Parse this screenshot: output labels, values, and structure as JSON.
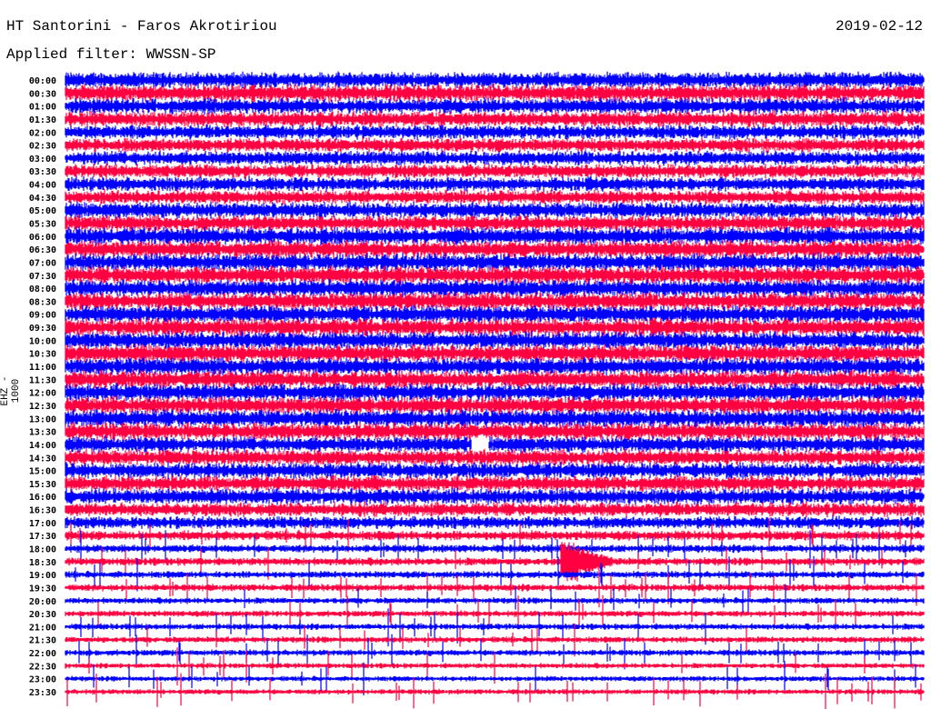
{
  "header": {
    "station": "HT Santorini - Faros Akrotiriou",
    "date": "2019-02-12",
    "filter": "Applied filter: WWSSN-SP"
  },
  "chart_data": {
    "type": "line",
    "subtype": "helicorder",
    "channel_label": "EHZ - 1000",
    "minutes_per_row": 30,
    "colors": [
      "#0000ff",
      "#ff0040"
    ],
    "rows": [
      {
        "label": "00:00",
        "amp": 0.9
      },
      {
        "label": "00:30",
        "amp": 1.0
      },
      {
        "label": "01:00",
        "amp": 0.9
      },
      {
        "label": "01:30",
        "amp": 0.9
      },
      {
        "label": "02:00",
        "amp": 0.8
      },
      {
        "label": "02:30",
        "amp": 0.8
      },
      {
        "label": "03:00",
        "amp": 0.8
      },
      {
        "label": "03:30",
        "amp": 0.8
      },
      {
        "label": "04:00",
        "amp": 0.8
      },
      {
        "label": "04:30",
        "amp": 0.8
      },
      {
        "label": "05:00",
        "amp": 0.9
      },
      {
        "label": "05:30",
        "amp": 0.9
      },
      {
        "label": "06:00",
        "amp": 1.0
      },
      {
        "label": "06:30",
        "amp": 1.0
      },
      {
        "label": "07:00",
        "amp": 1.0
      },
      {
        "label": "07:30",
        "amp": 1.0
      },
      {
        "label": "08:00",
        "amp": 1.0
      },
      {
        "label": "08:30",
        "amp": 1.0
      },
      {
        "label": "09:00",
        "amp": 1.0
      },
      {
        "label": "09:30",
        "amp": 1.0
      },
      {
        "label": "10:00",
        "amp": 1.0
      },
      {
        "label": "10:30",
        "amp": 1.0
      },
      {
        "label": "11:00",
        "amp": 1.0
      },
      {
        "label": "11:30",
        "amp": 1.0
      },
      {
        "label": "12:00",
        "amp": 1.0
      },
      {
        "label": "12:30",
        "amp": 1.0
      },
      {
        "label": "13:00",
        "amp": 1.0
      },
      {
        "label": "13:30",
        "amp": 1.0
      },
      {
        "label": "14:00",
        "amp": 0.9
      },
      {
        "label": "14:30",
        "amp": 0.9
      },
      {
        "label": "15:00",
        "amp": 0.9
      },
      {
        "label": "15:30",
        "amp": 0.9
      },
      {
        "label": "16:00",
        "amp": 0.9
      },
      {
        "label": "16:30",
        "amp": 0.8
      },
      {
        "label": "17:00",
        "amp": 0.7
      },
      {
        "label": "17:30",
        "amp": 0.55
      },
      {
        "label": "18:00",
        "amp": 0.45
      },
      {
        "label": "18:30",
        "amp": 0.45
      },
      {
        "label": "19:00",
        "amp": 0.4
      },
      {
        "label": "19:30",
        "amp": 0.4
      },
      {
        "label": "20:00",
        "amp": 0.35
      },
      {
        "label": "20:30",
        "amp": 0.35
      },
      {
        "label": "21:00",
        "amp": 0.35
      },
      {
        "label": "21:30",
        "amp": 0.35
      },
      {
        "label": "22:00",
        "amp": 0.35
      },
      {
        "label": "22:30",
        "amp": 0.3
      },
      {
        "label": "23:00",
        "amp": 0.3
      },
      {
        "label": "23:30",
        "amp": 0.3
      }
    ],
    "events": [
      {
        "row": "14:00",
        "minute": 14.5,
        "type": "gap"
      },
      {
        "row": "18:30",
        "minute": 17.6,
        "type": "quake"
      }
    ]
  }
}
